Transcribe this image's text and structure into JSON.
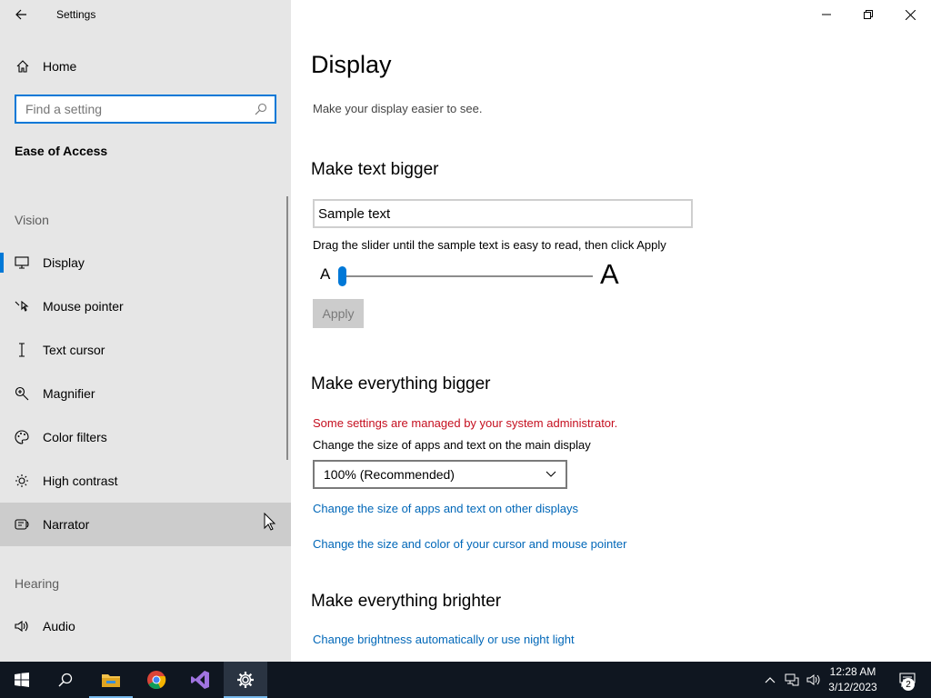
{
  "window": {
    "title": "Settings"
  },
  "sidebar": {
    "home_label": "Home",
    "search_placeholder": "Find a setting",
    "section_title": "Ease of Access",
    "group_vision": "Vision",
    "items": [
      {
        "label": "Display",
        "icon": "monitor-icon",
        "selected": true
      },
      {
        "label": "Mouse pointer",
        "icon": "mouse-pointer-icon"
      },
      {
        "label": "Text cursor",
        "icon": "text-cursor-icon"
      },
      {
        "label": "Magnifier",
        "icon": "magnifier-icon"
      },
      {
        "label": "Color filters",
        "icon": "palette-icon"
      },
      {
        "label": "High contrast",
        "icon": "brightness-icon"
      },
      {
        "label": "Narrator",
        "icon": "narrator-icon",
        "hovered": true
      }
    ],
    "group_hearing": "Hearing",
    "hearing_items": [
      {
        "label": "Audio",
        "icon": "speaker-icon"
      }
    ]
  },
  "main": {
    "title": "Display",
    "subtitle": "Make your display easier to see.",
    "text_bigger": {
      "heading": "Make text bigger",
      "sample_text": "Sample text",
      "hint": "Drag the slider until the sample text is easy to read, then click Apply",
      "slider_small": "A",
      "slider_large": "A",
      "slider_value_percent": 0,
      "apply_label": "Apply"
    },
    "everything_bigger": {
      "heading": "Make everything bigger",
      "warning": "Some settings are managed by your system administrator.",
      "label": "Change the size of apps and text on the main display",
      "dropdown_value": "100% (Recommended)",
      "link_other_displays": "Change the size of apps and text on other displays",
      "link_cursor": "Change the size and color of your cursor and mouse pointer"
    },
    "brighter": {
      "heading": "Make everything brighter",
      "link_brightness": "Change brightness automatically or use night light"
    }
  },
  "taskbar": {
    "time": "12:28 AM",
    "date": "3/12/2023",
    "notification_count": "2",
    "apps": [
      "windows-start-icon",
      "search-icon",
      "file-explorer-icon",
      "chrome-icon",
      "visual-studio-icon",
      "settings-gear-icon"
    ]
  },
  "colors": {
    "accent": "#0078d7",
    "link": "#0067b8",
    "warning": "#c50f1f",
    "sidebar_bg": "#e6e6e6",
    "taskbar_bg": "#0f1620"
  }
}
